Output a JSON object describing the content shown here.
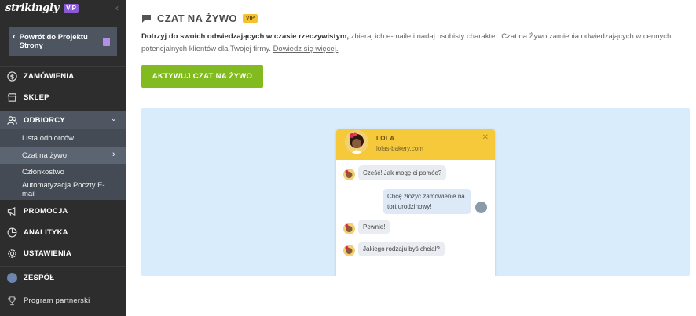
{
  "brand": {
    "name": "strikingly",
    "badge": "VIP"
  },
  "sidebar": {
    "back_label": "Powrót do Projektu Strony",
    "items": [
      {
        "label": "ZAMÓWIENIA",
        "icon": "dollar-icon"
      },
      {
        "label": "SKLEP",
        "icon": "store-icon"
      },
      {
        "label": "ODBIORCY",
        "icon": "users-icon"
      },
      {
        "label": "PROMOCJA",
        "icon": "megaphone-icon"
      },
      {
        "label": "ANALITYKA",
        "icon": "pie-chart-icon"
      },
      {
        "label": "USTAWIENIA",
        "icon": "gear-icon"
      },
      {
        "label": "ZESPÓŁ",
        "icon": "team-avatar-icon"
      },
      {
        "label": "Program partnerski",
        "icon": "trophy-icon"
      }
    ],
    "sub_items": [
      {
        "label": "Lista odbiorców"
      },
      {
        "label": "Czat na żywo"
      },
      {
        "label": "Członkostwo"
      },
      {
        "label": "Automatyzacja Poczty E-mail"
      }
    ]
  },
  "main": {
    "title": "CZAT NA ŻYWO",
    "title_badge": "VIP",
    "desc_bold": "Dotrzyj do swoich odwiedzających w czasie rzeczywistym,",
    "desc_text": " zbieraj ich e-maile i nadaj osobisty charakter. Czat na Żywo zamienia odwiedzających w cennych potencjalnych klientów dla Twojej firmy. ",
    "desc_link": "Dowiedz się więcej.",
    "cta_label": "AKTYWUJ CZAT NA ŻYWO"
  },
  "widget": {
    "name": "LOLA",
    "site": "lolas-bakery.com",
    "close": "✕",
    "messages": [
      {
        "from": "agent",
        "text": "Cześć! Jak mogę ci pomóc?"
      },
      {
        "from": "user",
        "text": "Chcę złożyć zamówienie na tort urodzinowy!"
      },
      {
        "from": "agent",
        "text": "Pewnie!"
      },
      {
        "from": "agent",
        "text": "Jakiego rodzaju byś chciał?"
      }
    ]
  },
  "colors": {
    "sidebar_bg": "#2d2d2e",
    "accent_green": "#82bb1f",
    "vip_purple": "#8a5ad6",
    "vip_yellow": "#f6c12f",
    "preview_bg": "#d9ecfb"
  }
}
